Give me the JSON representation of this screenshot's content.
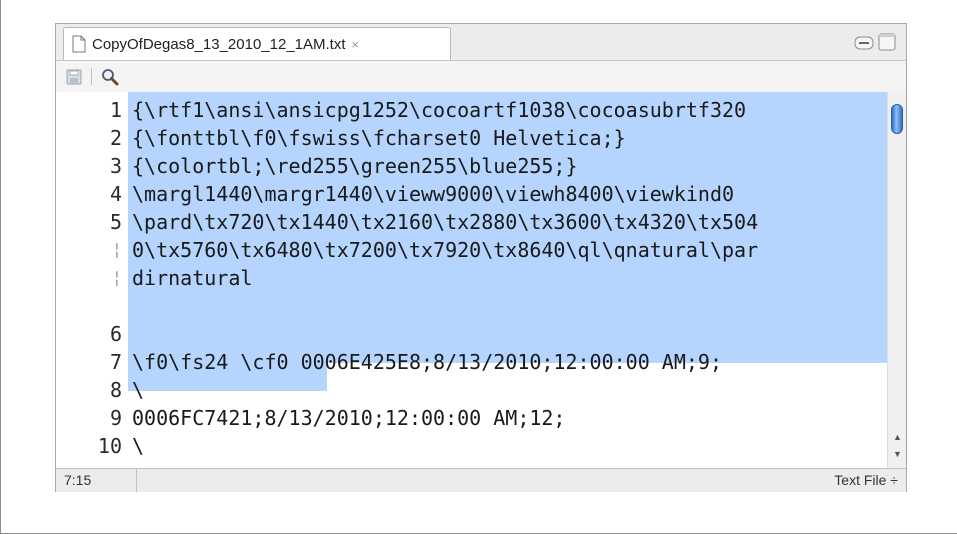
{
  "tab": {
    "filename": "CopyOfDegas8_13_2010_12_1AM.txt",
    "close_glyph": "×"
  },
  "toolbar": {
    "save_icon": "disk-icon",
    "search_icon": "magnifier-icon"
  },
  "editor": {
    "gutter": [
      "1",
      "2",
      "3",
      "4",
      "5",
      "¦",
      "¦",
      "6",
      "7",
      "8",
      "9",
      "10"
    ],
    "lines": [
      "{\\rtf1\\ansi\\ansicpg1252\\cocoartf1038\\cocoasubrtf320",
      "{\\fonttbl\\f0\\fswiss\\fcharset0 Helvetica;}",
      "{\\colortbl;\\red255\\green255\\blue255;}",
      "\\margl1440\\margr1440\\vieww9000\\viewh8400\\viewkind0",
      "\\pard\\tx720\\tx1440\\tx2160\\tx2880\\tx3600\\tx4320\\tx504",
      "0\\tx5760\\tx6480\\tx7200\\tx7920\\tx8640\\ql\\qnatural\\par",
      "dirnatural",
      "",
      "\\f0\\fs24 \\cf0 0006E425E8;8/13/2010;12:00:00 AM;9;",
      "\\",
      "0006FC7421;8/13/2010;12:00:00 AM;12;",
      "\\"
    ],
    "selection_color": "#b5d5ff"
  },
  "status": {
    "cursor_position": "7:15",
    "file_type": "Text File ÷"
  }
}
